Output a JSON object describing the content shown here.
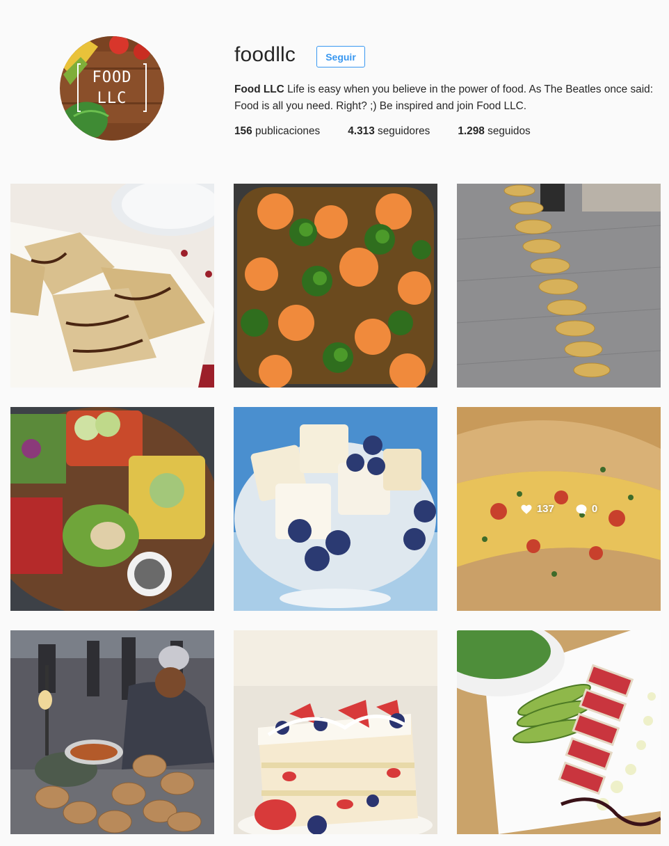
{
  "profile": {
    "username": "foodllc",
    "follow_label": "Seguir",
    "avatar_line1": "FOOD",
    "avatar_line2": "LLC",
    "bio_name": "Food LLC",
    "bio_text": " Life is easy when you believe in the power of food. As The Beatles once said: Food is all you need. Right? ;) Be inspired and join Food LLC."
  },
  "stats": {
    "posts_count": "156",
    "posts_label": " publicaciones",
    "followers_count": "4.313",
    "followers_label": " seguidores",
    "following_count": "1.298",
    "following_label": " seguidos"
  },
  "posts": [
    {
      "subject": "ravioli with chocolate drizzle"
    },
    {
      "subject": "shrimp and broccoli stir fry"
    },
    {
      "subject": "spiral potato on a stick"
    },
    {
      "subject": "open-faced toasts with avocado"
    },
    {
      "subject": "angel cake with blueberries"
    },
    {
      "subject": "baked calzone",
      "likes": "137",
      "comments": "0"
    },
    {
      "subject": "street food vendor with bread"
    },
    {
      "subject": "berry layered cake"
    },
    {
      "subject": "seared tuna with avocado"
    }
  ],
  "icons": {
    "like": "heart-icon",
    "comment": "comment-bubble-icon"
  },
  "colors": {
    "accent": "#3897f0",
    "background": "#fafafa",
    "text": "#262626"
  }
}
